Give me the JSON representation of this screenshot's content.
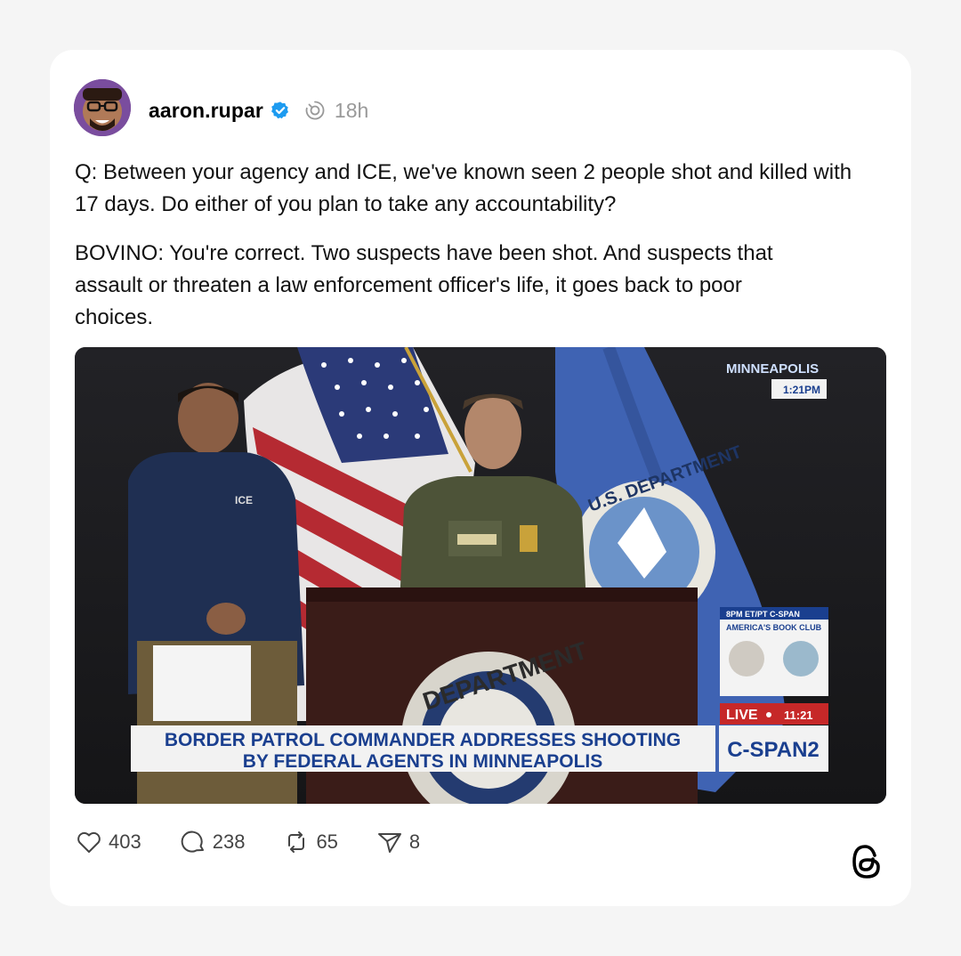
{
  "post": {
    "username": "aaron.rupar",
    "time": "18h",
    "paragraphs": [
      "Q: Between your agency and ICE, we've known seen 2 people shot and killed with 17 days. Do either of you plan to take any accountability?",
      "BOVINO: You're correct. Two suspects have been shot. And suspects that assault or threaten a law enforcement officer's life, it goes back to poor choices."
    ]
  },
  "media": {
    "location_bug": "MINNEAPOLIS",
    "location_time": "1:21PM",
    "chyron_line1": "BORDER PATROL COMMANDER ADDRESSES SHOOTING",
    "chyron_line2": "BY FEDERAL AGENTS IN MINNEAPOLIS",
    "network": "C-SPAN2",
    "live_label": "LIVE",
    "live_time": "11:21",
    "promo_title": "AMERICA'S BOOK CLUB",
    "promo_time": "8PM ET/PT C-SPAN",
    "podium_seal_text": "DEPARTMENT",
    "flag_seal_text": "U.S. DEPARTMENT",
    "jacket_text": "ICE"
  },
  "actions": {
    "likes": "403",
    "replies": "238",
    "reposts": "65",
    "shares": "8"
  },
  "colors": {
    "verified": "#1d9bf0",
    "chyron_bg": "#f2f2f2",
    "chyron_text": "#1a3f8f",
    "live_bg": "#c62828"
  },
  "icons": [
    "verified-badge-icon",
    "thread-activity-icon",
    "heart-icon",
    "reply-icon",
    "repost-icon",
    "share-icon",
    "threads-logo-icon"
  ]
}
